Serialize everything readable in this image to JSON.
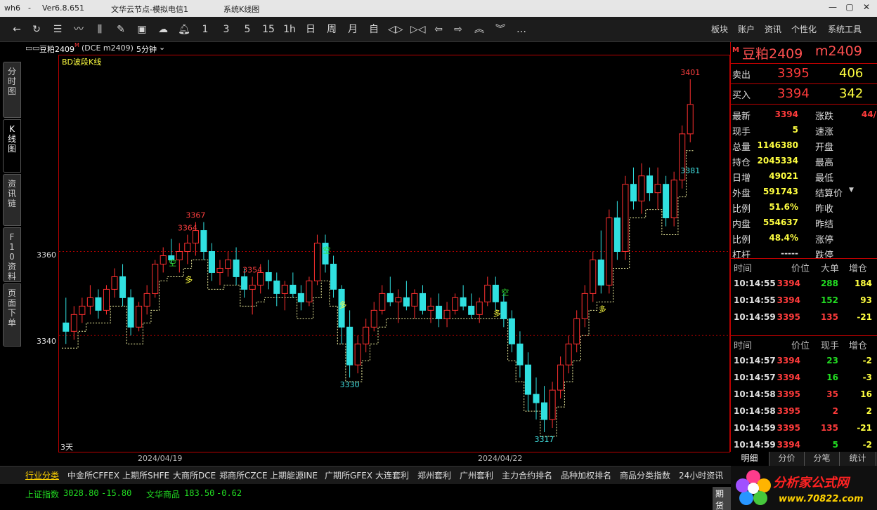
{
  "window": {
    "app": "wh6",
    "version": "Ver6.8.651",
    "server": "文华云节点-模拟电信1",
    "mode": "系统K线图"
  },
  "toolbar": {
    "periods": [
      "1",
      "3",
      "5",
      "15",
      "1h",
      "日",
      "周",
      "月",
      "自"
    ],
    "right_menu": [
      "板块",
      "账户",
      "资讯",
      "个性化",
      "系统工具"
    ],
    "more": "…"
  },
  "side_tabs": [
    "分时图",
    "K线图",
    "资讯链",
    "F10资料",
    "页面下单"
  ],
  "chart_header": {
    "contract": "豆粕2409",
    "flag": "M",
    "code": "(DCE m2409)",
    "period": "5分钟"
  },
  "indicator": "BD波段K线",
  "chart_data": {
    "type": "candlestick",
    "y_ticks": [
      3360,
      3340
    ],
    "ylim": [
      3315,
      3403
    ],
    "x_ticks": [
      "2024/04/19",
      "2024/04/22"
    ],
    "range_label": "3天",
    "peak_labels": [
      {
        "text": "3367",
        "value": 3367
      },
      {
        "text": "3364",
        "value": 3364
      },
      {
        "text": "3354",
        "value": 3354
      },
      {
        "text": "3401",
        "value": 3401
      }
    ],
    "trough_labels": [
      {
        "text": "3330",
        "value": 3330
      },
      {
        "text": "3317",
        "value": 3317
      },
      {
        "text": "3381",
        "value": 3381
      }
    ],
    "signals": [
      "空",
      "多",
      "空",
      "多",
      "空",
      "多",
      "多"
    ],
    "bars": [
      [
        3343,
        3349,
        3338,
        3341
      ],
      [
        3341,
        3347,
        3339,
        3345
      ],
      [
        3345,
        3349,
        3343,
        3347
      ],
      [
        3347,
        3352,
        3345,
        3349
      ],
      [
        3349,
        3351,
        3344,
        3346
      ],
      [
        3346,
        3352,
        3345,
        3351
      ],
      [
        3351,
        3356,
        3349,
        3354
      ],
      [
        3354,
        3357,
        3347,
        3349
      ],
      [
        3349,
        3351,
        3340,
        3342
      ],
      [
        3342,
        3348,
        3341,
        3347
      ],
      [
        3347,
        3352,
        3345,
        3350
      ],
      [
        3350,
        3358,
        3349,
        3357
      ],
      [
        3357,
        3361,
        3355,
        3359
      ],
      [
        3359,
        3363,
        3357,
        3358
      ],
      [
        3358,
        3362,
        3355,
        3360
      ],
      [
        3360,
        3364,
        3357,
        3362
      ],
      [
        3362,
        3367,
        3359,
        3365
      ],
      [
        3365,
        3367,
        3358,
        3360
      ],
      [
        3360,
        3362,
        3353,
        3355
      ],
      [
        3355,
        3358,
        3352,
        3356
      ],
      [
        3356,
        3360,
        3354,
        3358
      ],
      [
        3358,
        3361,
        3352,
        3354
      ],
      [
        3354,
        3356,
        3349,
        3351
      ],
      [
        3351,
        3354,
        3345,
        3352
      ],
      [
        3352,
        3357,
        3350,
        3355
      ],
      [
        3355,
        3358,
        3351,
        3353
      ],
      [
        3353,
        3355,
        3347,
        3350
      ],
      [
        3350,
        3353,
        3346,
        3352
      ],
      [
        3352,
        3355,
        3349,
        3350
      ],
      [
        3350,
        3352,
        3346,
        3348
      ],
      [
        3348,
        3354,
        3347,
        3353
      ],
      [
        3353,
        3364,
        3352,
        3362
      ],
      [
        3362,
        3364,
        3355,
        3357
      ],
      [
        3357,
        3359,
        3349,
        3351
      ],
      [
        3351,
        3352,
        3338,
        3342
      ],
      [
        3342,
        3346,
        3330,
        3333
      ],
      [
        3333,
        3340,
        3331,
        3338
      ],
      [
        3338,
        3344,
        3336,
        3342
      ],
      [
        3342,
        3348,
        3341,
        3346
      ],
      [
        3346,
        3352,
        3345,
        3350
      ],
      [
        3350,
        3354,
        3347,
        3348
      ],
      [
        3348,
        3351,
        3343,
        3349
      ],
      [
        3349,
        3353,
        3346,
        3347
      ],
      [
        3347,
        3351,
        3344,
        3350
      ],
      [
        3350,
        3352,
        3345,
        3346
      ],
      [
        3346,
        3349,
        3343,
        3347
      ],
      [
        3347,
        3350,
        3342,
        3344
      ],
      [
        3344,
        3348,
        3342,
        3346
      ],
      [
        3346,
        3350,
        3345,
        3349
      ],
      [
        3349,
        3352,
        3346,
        3347
      ],
      [
        3347,
        3350,
        3344,
        3345
      ],
      [
        3345,
        3349,
        3343,
        3348
      ],
      [
        3348,
        3354,
        3347,
        3352
      ],
      [
        3352,
        3354,
        3346,
        3348
      ],
      [
        3348,
        3350,
        3342,
        3344
      ],
      [
        3344,
        3346,
        3336,
        3338
      ],
      [
        3338,
        3341,
        3330,
        3333
      ],
      [
        3333,
        3336,
        3322,
        3326
      ],
      [
        3326,
        3330,
        3320,
        3324
      ],
      [
        3324,
        3328,
        3317,
        3320
      ],
      [
        3320,
        3329,
        3318,
        3327
      ],
      [
        3327,
        3335,
        3325,
        3333
      ],
      [
        3333,
        3340,
        3331,
        3338
      ],
      [
        3338,
        3346,
        3336,
        3344
      ],
      [
        3344,
        3352,
        3342,
        3350
      ],
      [
        3350,
        3360,
        3348,
        3358
      ],
      [
        3358,
        3365,
        3350,
        3352
      ],
      [
        3352,
        3370,
        3350,
        3368
      ],
      [
        3368,
        3372,
        3358,
        3360
      ],
      [
        3360,
        3378,
        3358,
        3376
      ],
      [
        3376,
        3380,
        3370,
        3372
      ],
      [
        3372,
        3381,
        3369,
        3378
      ],
      [
        3378,
        3380,
        3372,
        3374
      ],
      [
        3374,
        3380,
        3370,
        3376
      ],
      [
        3376,
        3378,
        3366,
        3368
      ],
      [
        3368,
        3379,
        3366,
        3377
      ],
      [
        3377,
        3390,
        3375,
        3388
      ],
      [
        3388,
        3401,
        3386,
        3395
      ]
    ]
  },
  "quote": {
    "flag": "M",
    "name": "豆粕2409",
    "code": "m2409",
    "sell_label": "卖出",
    "sell_price": "3395",
    "sell_vol": "406",
    "buy_label": "买入",
    "buy_price": "3394",
    "buy_vol": "342",
    "rows": [
      {
        "label": "最新",
        "value": "3394",
        "label2": "涨跌",
        "value2": "44/"
      },
      {
        "label": "现手",
        "value": "5",
        "label2": "速涨",
        "value2": ""
      },
      {
        "label": "总量",
        "value": "1146380",
        "label2": "开盘",
        "value2": ""
      },
      {
        "label": "持仓",
        "value": "2045334",
        "label2": "最高",
        "value2": ""
      },
      {
        "label": "日增",
        "value": "49021",
        "label2": "最低",
        "value2": ""
      },
      {
        "label": "外盘",
        "value": "591743",
        "label2": "结算价",
        "value2": ""
      },
      {
        "label": "比例",
        "value": "51.6%",
        "label2": "昨收",
        "value2": ""
      },
      {
        "label": "内盘",
        "value": "554637",
        "label2": "昨结",
        "value2": ""
      },
      {
        "label": "比例",
        "value": "48.4%",
        "label2": "涨停",
        "value2": ""
      },
      {
        "label": "杠杆",
        "value": "-----",
        "label2": "跌停",
        "value2": ""
      }
    ]
  },
  "big_orders": {
    "headers": [
      "时间",
      "价位",
      "大单",
      "增仓"
    ],
    "rows": [
      [
        "10:14:55",
        "3394",
        "288",
        "184"
      ],
      [
        "10:14:55",
        "3394",
        "152",
        "93"
      ],
      [
        "10:14:59",
        "3395",
        "135",
        "-21"
      ]
    ]
  },
  "ticks": {
    "headers": [
      "时间",
      "价位",
      "现手",
      "增仓"
    ],
    "rows": [
      [
        "10:14:57",
        "3394",
        "23",
        "-2"
      ],
      [
        "10:14:57",
        "3394",
        "16",
        "-3"
      ],
      [
        "10:14:58",
        "3395",
        "35",
        "16"
      ],
      [
        "10:14:58",
        "3395",
        "2",
        "2"
      ],
      [
        "10:14:59",
        "3395",
        "135",
        "-21"
      ],
      [
        "10:14:59",
        "3394",
        "5",
        "-2"
      ]
    ]
  },
  "bottom_tabs": [
    "明细",
    "分价",
    "分笔",
    "统计"
  ],
  "bottom_menu": [
    "行业分类",
    "中金所CFFEX",
    "上期所SHFE",
    "大商所DCE",
    "郑商所CZCE",
    "上期能源INE",
    "广期所GFEX",
    "大连套利",
    "郑州套利",
    "广州套利",
    "主力合约排名",
    "品种加权排名",
    "商品分类指数",
    "24小时资讯"
  ],
  "status": {
    "idx1_name": "上证指数",
    "idx1_val": "3028.80",
    "idx1_chg": "-15.80",
    "idx2_name": "文华商品",
    "idx2_val": "183.50",
    "idx2_chg": "-0.62",
    "btn": "期货"
  },
  "ad": {
    "brand": "分析家公式网",
    "url": "www.70822.com"
  }
}
